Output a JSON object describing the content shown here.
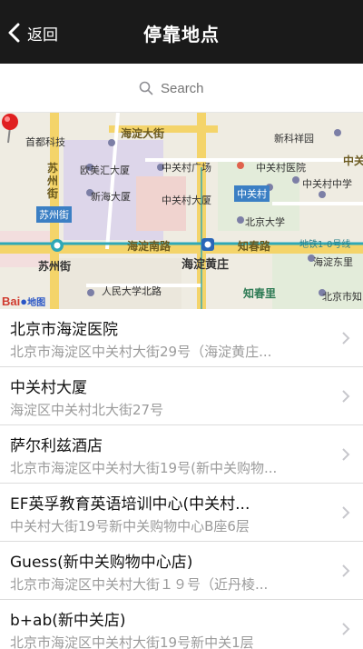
{
  "navbar": {
    "back_label": "返回",
    "title": "停靠地点"
  },
  "search": {
    "placeholder": "Search"
  },
  "map": {
    "labels": {
      "shouduKeji": "首都科技",
      "haidianDajie": "海淀大街",
      "xinkeXiangyuan": "新科祥园",
      "suzhou": "苏",
      "zhou": "州",
      "jie": "街",
      "suzhouJieBadge": "苏州街",
      "ouMeiHui": "欧美汇大厦",
      "xinHaiDasha": "新海大厦",
      "zhongguancunGuangchang": "中关村广场",
      "zhongguancunYiyuan": "中关村医院",
      "zhongguancunDasha": "中关村大厦",
      "zhongguancunBadge": "中关村",
      "zhongguancunZhongxue": "中关村中学",
      "beijingDaxue": "北京大学",
      "haidianNanlu": "海淀南路",
      "zhichunlu": "知春路",
      "ditie": "地铁1-0号线",
      "suzhouJie": "苏州街",
      "haidianHuangzhuang": "海淀黄庄",
      "haidianDongli": "海淀东里",
      "renminDaxueBeilu": "人民大学北路",
      "zhichunli": "知春里",
      "beijingShiZhichun": "北京市知",
      "zhongguan": "中关"
    },
    "baidu_logo": "Bai",
    "baidu_suffix": "地图"
  },
  "places": [
    {
      "name": "北京市海淀医院",
      "address": "北京市海淀区中关村大街29号（海淀黄庄..."
    },
    {
      "name": "中关村大厦",
      "address": "海淀区中关村北大街27号"
    },
    {
      "name": "萨尔利兹酒店",
      "address": "北京市海淀区中关村大街19号(新中关购物..."
    },
    {
      "name": "EF英孚教育英语培训中心(中关村...",
      "address": "中关村大街19号新中关购物中心B座6层"
    },
    {
      "name": "Guess(新中关购物中心店)",
      "address": "北京市海淀区中关村大街１９号（近丹棱..."
    },
    {
      "name": "b+ab(新中关店)",
      "address": "北京市海淀区中关村大街19号新中关1层"
    }
  ],
  "colors": {
    "navbar_bg": "#1a1a1a",
    "pin": "#e02020",
    "metro_line": "#2fa8b6",
    "badge_blue": "#3b7fc4"
  }
}
